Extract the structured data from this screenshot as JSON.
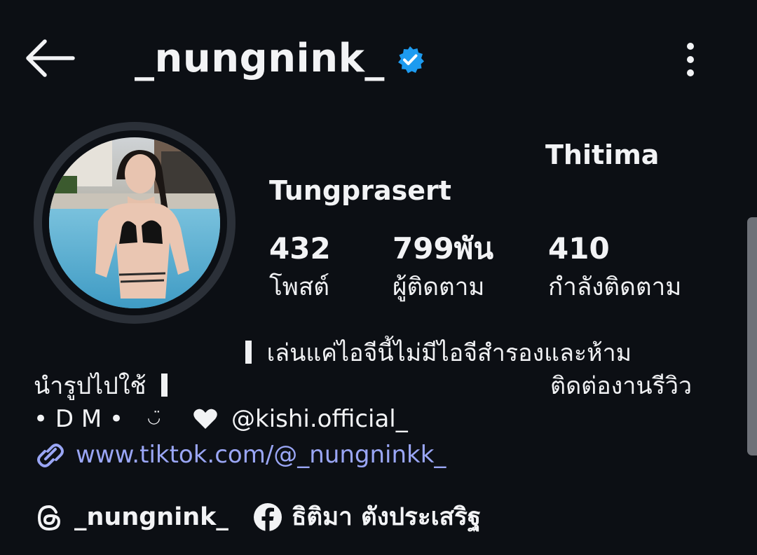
{
  "header": {
    "username": "_nungnink_",
    "verified_icon": "verified-badge-icon",
    "back_icon": "arrow-left-icon",
    "more_icon": "more-vertical-icon"
  },
  "profile": {
    "full_name_line1": "Thitima",
    "full_name_line2": "Tungprasert",
    "stats": {
      "posts": {
        "value": "432",
        "label": "โพสต์"
      },
      "followers": {
        "value": "799พัน",
        "label": "ผู้ติดตาม"
      },
      "following": {
        "value": "410",
        "label": "กำลังติดตาม"
      }
    },
    "bio": {
      "line1": "เล่นแค่ไอจีนี้ไม่มีไอจีสำรองและห้าม",
      "line2a": "นำรูปไปใช้",
      "line2b": "ติดต่องานรีวิว",
      "dm": "• D M •",
      "smile": "◡̈",
      "mention": "@kishi.official_",
      "link": "www.tiktok.com/@_nungninkk_"
    },
    "threads_handle": "_nungnink_",
    "facebook_name": "ธิติมา ตังประเสริฐ"
  },
  "colors": {
    "background": "#0c0f14",
    "verified": "#1d9bf0",
    "link": "#9aa6f5",
    "text": "#f2f3f5"
  }
}
